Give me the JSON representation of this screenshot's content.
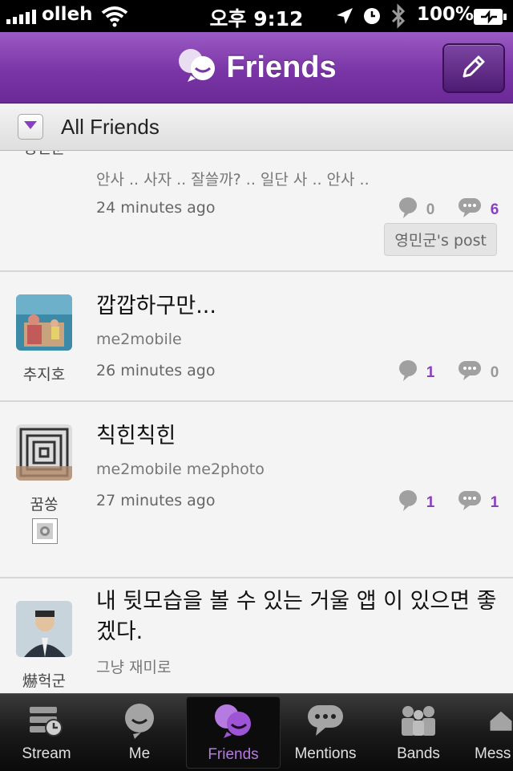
{
  "status_bar": {
    "carrier": "olleh",
    "time": "오후 9:12",
    "battery": "100%"
  },
  "header": {
    "title": "Friends",
    "compose_icon": "pencil-icon"
  },
  "filter": {
    "label": "All Friends"
  },
  "posts": [
    {
      "author": "영민군",
      "title": "",
      "tags": "안사 .. 사자 .. 잘쓸까? .. 일단 사 .. 안사 ..",
      "time": "24 minutes ago",
      "likes": "0",
      "comments": "6",
      "post_ref": "영민군's post"
    },
    {
      "author": "추지호",
      "title": "깝깝하구만...",
      "tags": "me2mobile",
      "time": "26 minutes ago",
      "likes": "1",
      "comments": "0"
    },
    {
      "author": "꿈쏭",
      "title": "칙힌칙힌",
      "tags": "me2mobile me2photo",
      "time": "27 minutes ago",
      "likes": "1",
      "comments": "1"
    },
    {
      "author": "爀헉군",
      "title": "내 뒷모습을 볼 수 있는 거울 앱 이 있으면 좋겠다.",
      "tags": "그냥 재미로",
      "time": ""
    }
  ],
  "tabs": [
    {
      "label": "Stream",
      "icon": "stream-icon"
    },
    {
      "label": "Me",
      "icon": "me-icon"
    },
    {
      "label": "Friends",
      "icon": "friends-icon",
      "active": true
    },
    {
      "label": "Mentions",
      "icon": "mentions-icon"
    },
    {
      "label": "Bands",
      "icon": "bands-icon"
    },
    {
      "label": "Mess",
      "icon": "messages-icon"
    }
  ],
  "colors": {
    "accent": "#8a3fc0",
    "nav_top": "#9b5bc4",
    "nav_bottom": "#6a2a96"
  }
}
